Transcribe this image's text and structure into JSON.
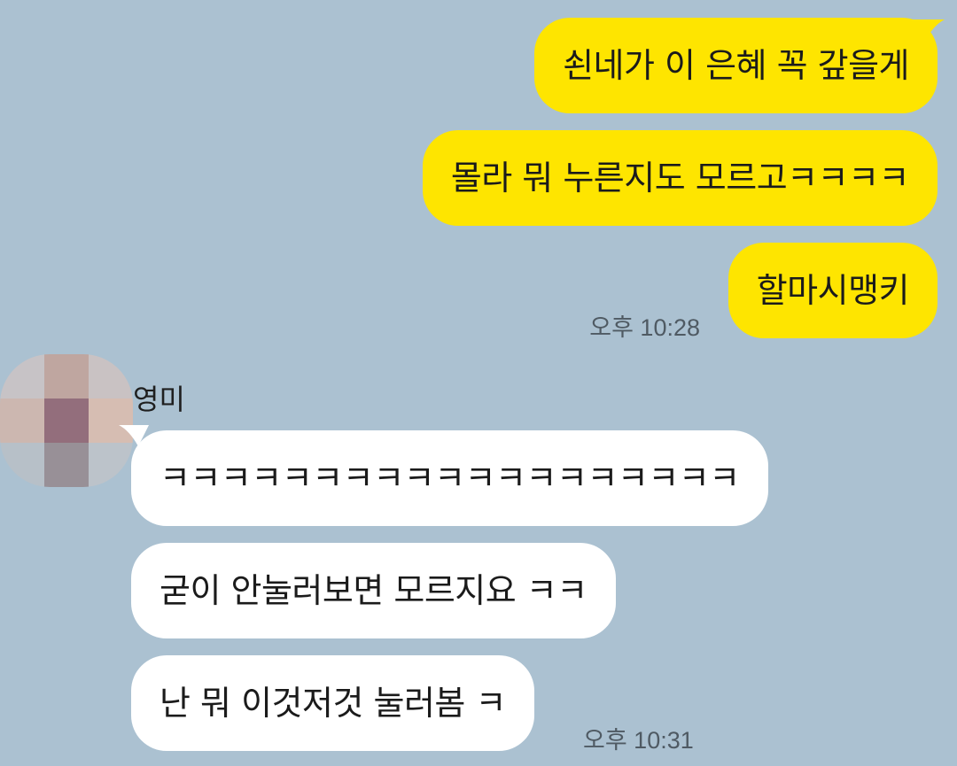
{
  "chat": {
    "background_color": "#abc1d1",
    "sent_bubble_color": "#fee500",
    "received_bubble_color": "#ffffff",
    "sent_messages": [
      {
        "text": "쇤네가 이 은혜 꼭 갚을게"
      },
      {
        "text": "몰라 뭐 누른지도 모르고ㅋㅋㅋㅋ"
      },
      {
        "text": "할마시맹키"
      }
    ],
    "sent_time": "오후 10:28",
    "sender": {
      "name": "영미",
      "avatar_pixels": [
        "#c7c3c6",
        "#bfa6a0",
        "#c9c2c3",
        "#ccb7b0",
        "#936e7c",
        "#d6bdb2",
        "#b7c0c8",
        "#989097",
        "#bcc3ca"
      ]
    },
    "received_messages": [
      {
        "text": "ㅋㅋㅋㅋㅋㅋㅋㅋㅋㅋㅋㅋㅋㅋㅋㅋㅋㅋㅋ"
      },
      {
        "text": "굳이 안눌러보면 모르지요 ㅋㅋ"
      },
      {
        "text": "난 뭐 이것저것 눌러봄 ㅋ"
      }
    ],
    "received_time": "오후 10:31"
  }
}
